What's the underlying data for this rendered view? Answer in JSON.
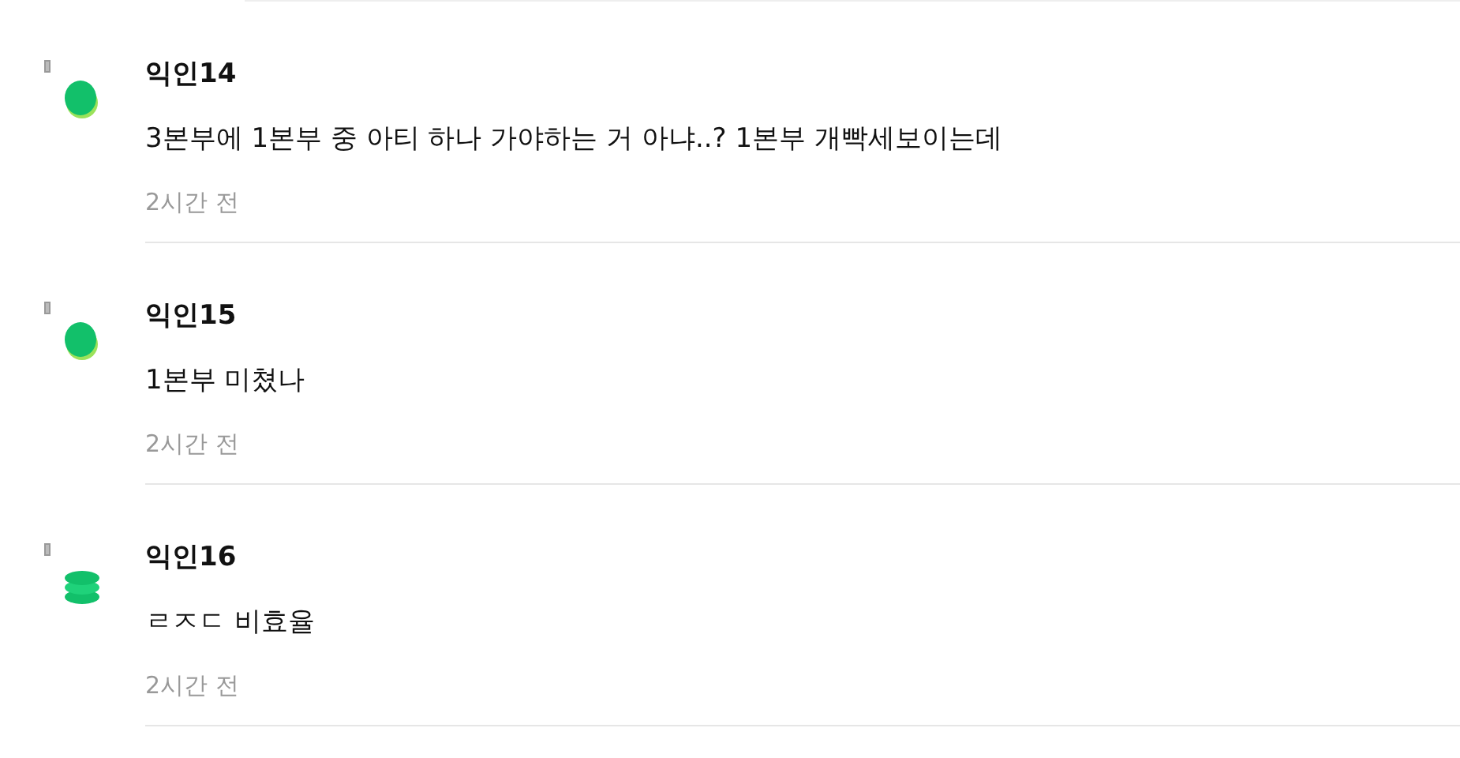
{
  "comments": [
    {
      "author": "익인14",
      "kind": "single",
      "text": "3본부에 1본부 중 아티 하나 가야하는 거 아냐..? 1본부 개빡세보이는데",
      "time": "2시간 전"
    },
    {
      "author": "익인15",
      "kind": "single",
      "text": "1본부 미쳤나",
      "time": "2시간 전"
    },
    {
      "author": "익인16",
      "kind": "stack",
      "text": "ㄹㅈㄷ 비효율",
      "time": "2시간 전"
    }
  ]
}
